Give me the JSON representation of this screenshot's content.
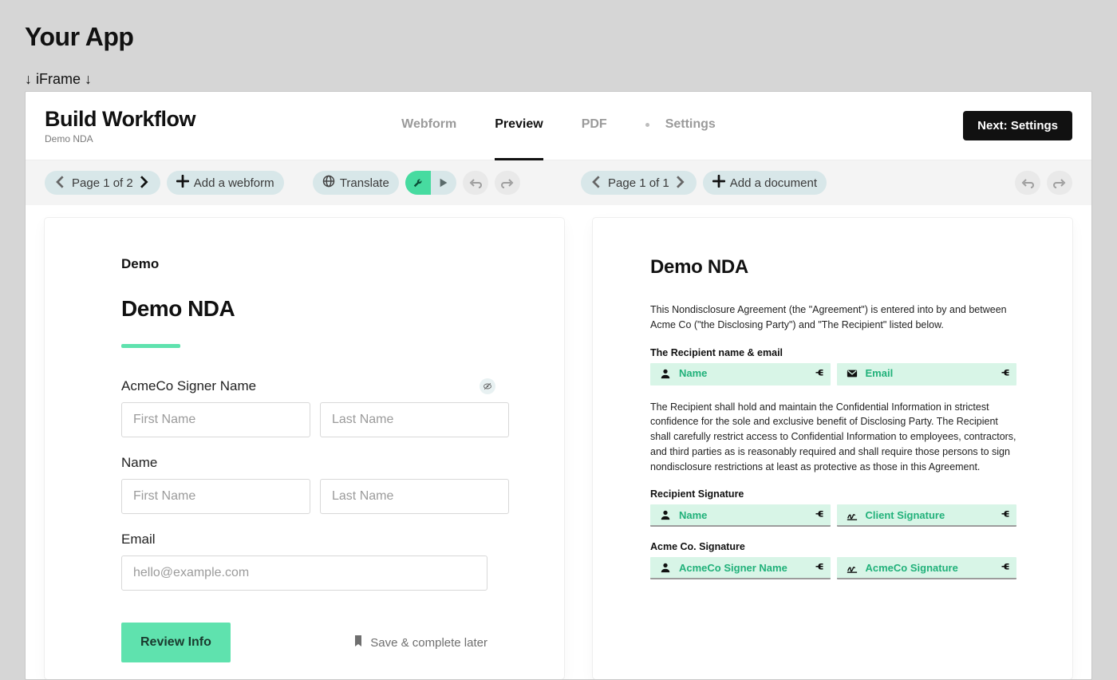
{
  "page": {
    "app_title": "Your App",
    "iframe_label": "↓ iFrame ↓"
  },
  "header": {
    "title": "Build Workflow",
    "subtitle": "Demo NDA",
    "tabs": {
      "webform": "Webform",
      "preview": "Preview",
      "pdf": "PDF",
      "settings": "Settings"
    },
    "next_button": "Next: Settings"
  },
  "toolbar": {
    "left_pager": "Page 1 of 2",
    "add_webform": "Add a webform",
    "translate": "Translate",
    "right_pager": "Page 1 of 1",
    "add_document": "Add a document"
  },
  "webform": {
    "brand": "Demo",
    "heading": "Demo NDA",
    "fields": {
      "acme_signer_label": "AcmeCo Signer Name",
      "name_label": "Name",
      "email_label": "Email",
      "first_name_placeholder": "First Name",
      "last_name_placeholder": "Last Name",
      "email_placeholder": "hello@example.com"
    },
    "review_button": "Review Info",
    "save_later": "Save & complete later"
  },
  "document": {
    "title": "Demo NDA",
    "intro": "This Nondisclosure Agreement (the \"Agreement\") is entered into by and between Acme Co (\"the Disclosing Party\") and \"The Recipient\" listed below.",
    "recipient_header": "The Recipient name & email",
    "chips": {
      "name": "Name",
      "email": "Email",
      "client_signature": "Client Signature",
      "acme_signer_name": "AcmeCo Signer Name",
      "acme_signature": "AcmeCo Signature"
    },
    "body": "The Recipient shall hold and maintain the Confidential Information in strictest confidence for the sole and exclusive benefit of Disclosing Party. The Recipient shall carefully restrict access to Confidential Information to employees, contractors, and third parties as is reasonably required and shall require those persons to sign nondisclosure restrictions at least as protective as those in this Agreement.",
    "recipient_sig_header": "Recipient Signature",
    "acme_sig_header": "Acme Co. Signature"
  }
}
